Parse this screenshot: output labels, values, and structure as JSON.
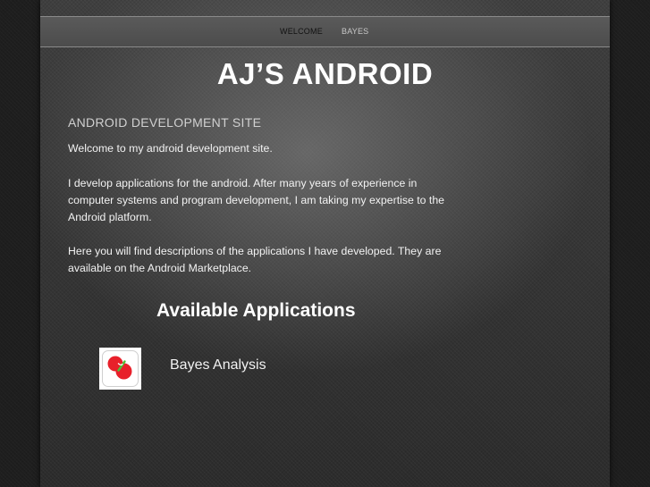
{
  "nav": {
    "items": [
      {
        "label": "WELCOME",
        "active": true
      },
      {
        "label": "BAYES",
        "active": false
      }
    ]
  },
  "site": {
    "title": "AJ’S ANDROID"
  },
  "content": {
    "section_title": "ANDROID DEVELOPMENT SITE",
    "paragraphs": [
      "Welcome to my android development site.",
      "I develop applications for the android.  After many years of experience in computer systems and program development, I am taking my expertise to the Android platform.",
      "Here you will find descriptions of the applications I have developed.  They are available on the Android Marketplace."
    ]
  },
  "apps": {
    "heading": "Available Applications",
    "items": [
      {
        "name": "Bayes Analysis",
        "icon": "bayes-venn-icon"
      }
    ]
  },
  "colors": {
    "accent_red": "#e8202a",
    "accent_green": "#4dc23a",
    "nav_active": "#111111",
    "nav_inactive": "#c8c8c8"
  }
}
